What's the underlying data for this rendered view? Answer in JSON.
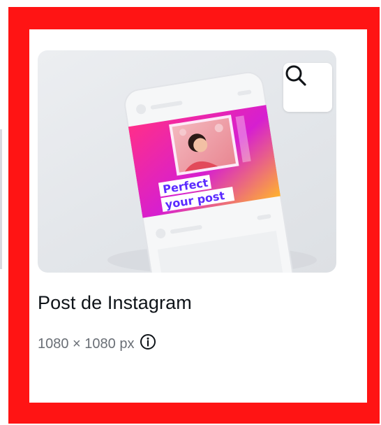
{
  "template_card": {
    "title": "Post de Instagram",
    "dimensions": "1080 × 1080 px",
    "preview": {
      "headline_line1": "Perfect",
      "headline_line2": "your post"
    },
    "icons": {
      "search": "magnifier-icon",
      "info": "info-circle-icon"
    }
  },
  "colors": {
    "frame": "#ff1414",
    "title": "#0e1318",
    "dimensions": "#6a6f76",
    "preview_gradient": [
      "#ff2e8a",
      "#b81de0",
      "#ffb22e"
    ],
    "headline_text": "#5b2bff"
  }
}
